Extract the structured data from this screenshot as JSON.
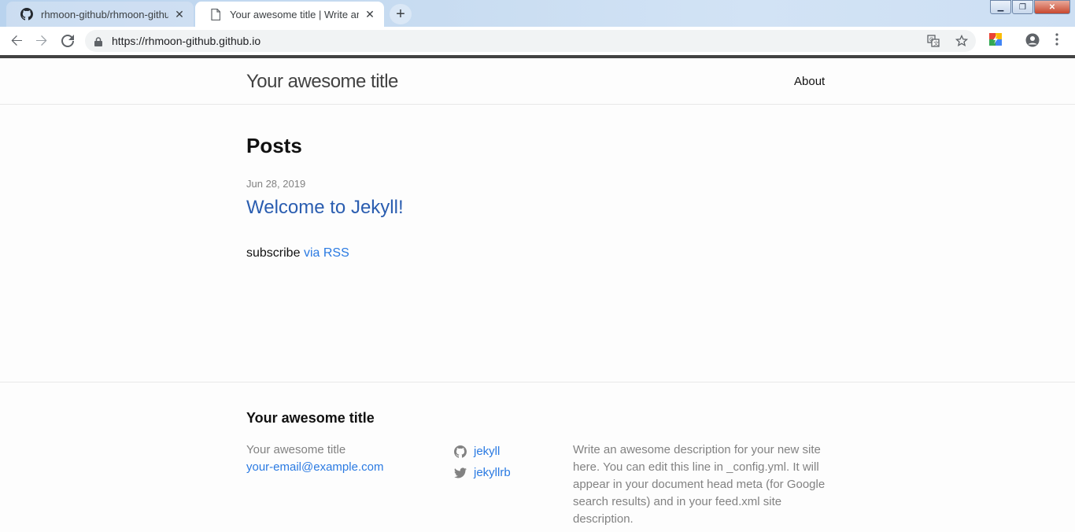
{
  "browser": {
    "tabs": [
      {
        "title": "rhmoon-github/rhmoon-github",
        "icon": "github-icon",
        "active": false
      },
      {
        "title": "Your awesome title | Write an",
        "icon": "page-icon",
        "active": true
      }
    ],
    "new_tab": "+",
    "address": "https://rhmoon-github.github.io"
  },
  "header": {
    "site_title": "Your awesome title",
    "nav_about": "About"
  },
  "main": {
    "heading": "Posts",
    "posts": [
      {
        "date": "Jun 28, 2019",
        "title": "Welcome to Jekyll!"
      }
    ],
    "subscribe_text": "subscribe",
    "rss_link": "via RSS"
  },
  "footer": {
    "heading": "Your awesome title",
    "name": "Your awesome title",
    "email": "your-email@example.com",
    "github_user": "jekyll",
    "twitter_user": "jekyllrb",
    "description": "Write an awesome description for your new site here. You can edit this line in _config.yml. It will appear in your document head meta (for Google search results) and in your feed.xml site description."
  },
  "colors": {
    "link": "#2a7ae2",
    "meta": "#828282",
    "text": "#111111",
    "header_border": "#e8e8e8"
  }
}
